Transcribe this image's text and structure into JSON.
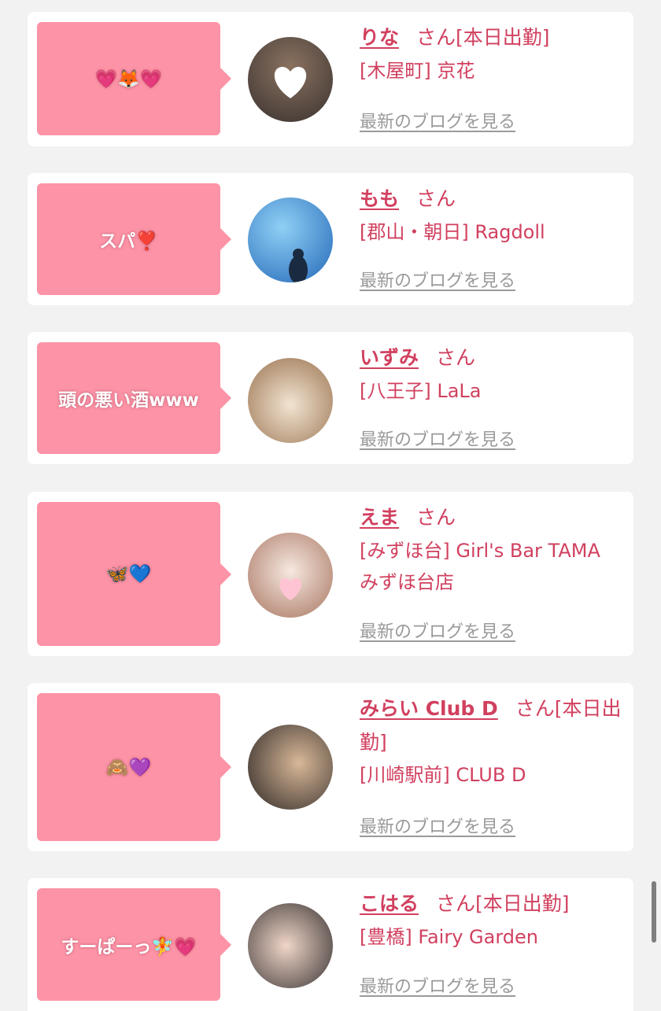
{
  "entries": [
    {
      "message": "💗🦊💗",
      "name": "りな",
      "san": "さん",
      "status": "[本日出勤]",
      "shop_lines": [
        "[木屋町] 京花"
      ],
      "blog_link": "最新のブログを見る",
      "avatar_colors": [
        "#8a7260",
        "#3a3230"
      ]
    },
    {
      "message": "スパ❣️",
      "name": "もも",
      "san": "さん",
      "status": "",
      "shop_lines": [
        "[郡山・朝日] Ragdoll"
      ],
      "blog_link": "最新のブログを見る",
      "avatar_colors": [
        "#6fb6ea",
        "#2468b8"
      ]
    },
    {
      "message": "頭の悪い酒www",
      "name": "いずみ",
      "san": "さん",
      "status": "",
      "shop_lines": [
        "[八王子] LaLa"
      ],
      "blog_link": "最新のブログを見る",
      "avatar_colors": [
        "#e9dccb",
        "#a07a58"
      ]
    },
    {
      "message": "🦋💙",
      "name": "えま",
      "san": "さん",
      "status": "",
      "shop_lines": [
        "[みずほ台] Girl's Bar TAMA",
        "みずほ台店"
      ],
      "blog_link": "最新のブログを見る",
      "avatar_colors": [
        "#f1e2da",
        "#b07a62"
      ]
    },
    {
      "message": "🙈💜",
      "name": "みらい Club D",
      "san": "さん",
      "status": "[本日出勤]",
      "shop_lines": [
        "[川崎駅前] CLUB D"
      ],
      "blog_link": "最新のブログを見る",
      "avatar_colors": [
        "#c8a888",
        "#2c2624"
      ]
    },
    {
      "message": "すーぱーっ🧚💗",
      "name": "こはる",
      "san": "さん",
      "status": "[本日出勤]",
      "shop_lines": [
        "[豊橋] Fairy Garden"
      ],
      "blog_link": "最新のブログを見る",
      "avatar_colors": [
        "#e8cdbf",
        "#3a3434"
      ]
    }
  ]
}
